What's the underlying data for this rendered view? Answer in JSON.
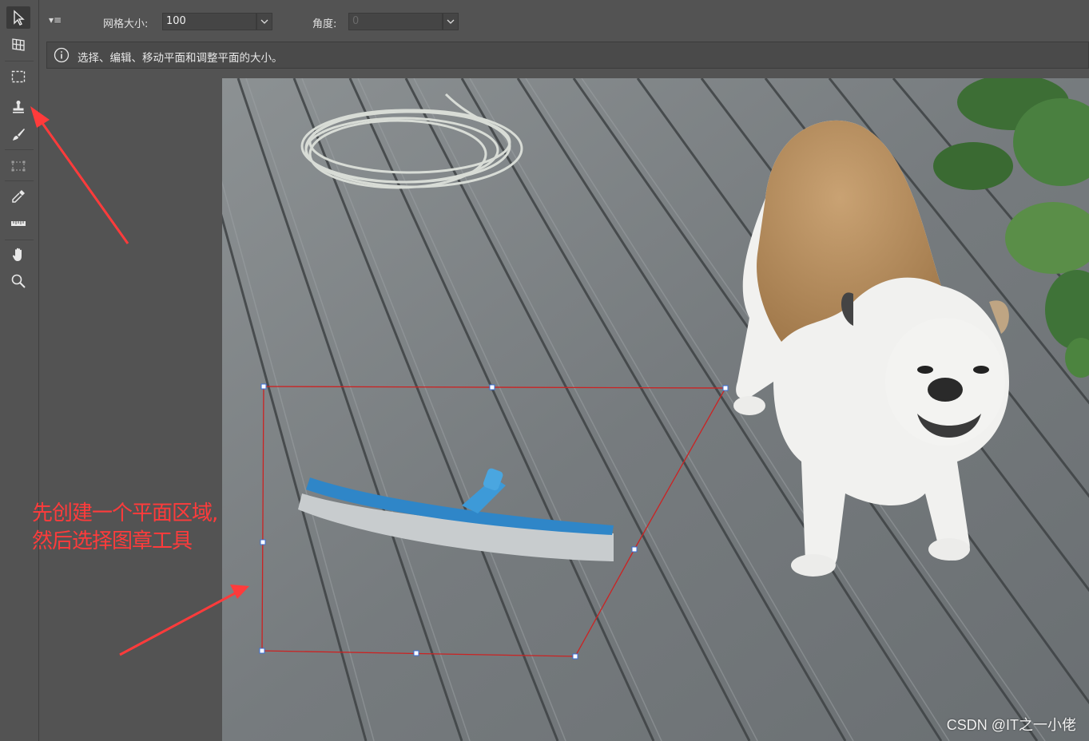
{
  "toolbar": {
    "tools": [
      {
        "name": "selection-tool",
        "icon": "arrow-cursor-icon"
      },
      {
        "name": "create-plane-tool",
        "icon": "grid-plane-icon"
      },
      {
        "name": "marquee-tool",
        "icon": "dashed-rectangle-icon"
      },
      {
        "name": "stamp-tool",
        "icon": "stamp-icon"
      },
      {
        "name": "brush-tool",
        "icon": "brush-icon"
      },
      {
        "name": "transform-tool",
        "icon": "transform-icon"
      },
      {
        "name": "eyedropper-tool",
        "icon": "eyedropper-icon"
      },
      {
        "name": "measure-tool",
        "icon": "ruler-icon"
      },
      {
        "name": "hand-tool",
        "icon": "hand-icon"
      },
      {
        "name": "zoom-tool",
        "icon": "magnifier-icon"
      }
    ]
  },
  "options": {
    "menu_icon": "▾≡",
    "grid_size_label": "网格大小:",
    "grid_size_value": "100",
    "angle_label": "角度:",
    "angle_value": "0"
  },
  "info": {
    "icon": "info-circle-icon",
    "text": "选择、编辑、移动平面和调整平面的大小。"
  },
  "annotation": {
    "line1": "先创建一个平面区域,",
    "line2": "然后选择图章工具"
  },
  "watermark": "CSDN @IT之一小佬",
  "colors": {
    "annotation": "#ff3b3b",
    "plane_outline": "#cc2222",
    "handle": "#3a6fd8"
  }
}
